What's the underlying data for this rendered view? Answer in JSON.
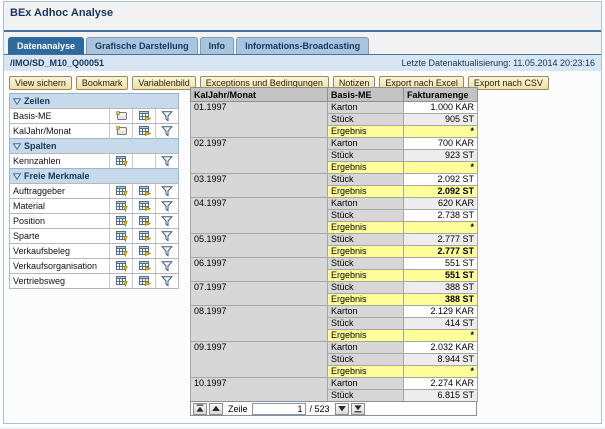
{
  "window": {
    "title": "BEx Adhoc Analyse"
  },
  "tabs": [
    {
      "id": "datenanalyse",
      "label": "Datenanalyse",
      "active": true
    },
    {
      "id": "grafische-darstellung",
      "label": "Grafische Darstellung",
      "active": false
    },
    {
      "id": "info",
      "label": "Info",
      "active": false
    },
    {
      "id": "informations-broadcasting",
      "label": "Informations-Broadcasting",
      "active": false
    }
  ],
  "query_bar": {
    "query_name": "/IMO/SD_M10_Q00051",
    "last_refresh": "Letzte Datenaktualisierung: 11.05.2014 20:23:16"
  },
  "toolbar": {
    "buttons": [
      {
        "id": "view-sichern",
        "label": "View sichern"
      },
      {
        "id": "bookmark",
        "label": "Bookmark"
      },
      {
        "id": "variablenbild",
        "label": "Variablenbild"
      },
      {
        "id": "exceptions-und-bedingungen",
        "label": "Exceptions und Bedingungen"
      },
      {
        "id": "notizen",
        "label": "Notizen"
      },
      {
        "id": "export-nach-excel",
        "label": "Export nach Excel"
      },
      {
        "id": "export-nach-csv",
        "label": "Export nach CSV"
      }
    ]
  },
  "navigation": {
    "sections": [
      {
        "id": "zeilen",
        "label": "Zeilen",
        "items": [
          {
            "id": "basis-me",
            "label": "Basis-ME",
            "icons": [
              "properties",
              "table-right",
              "filter"
            ]
          },
          {
            "id": "kaljahr-monat",
            "label": "KalJahr/Monat",
            "icons": [
              "properties",
              "table-right",
              "filter"
            ]
          }
        ]
      },
      {
        "id": "spalten",
        "label": "Spalten",
        "items": [
          {
            "id": "kennzahlen",
            "label": "Kennzahlen",
            "icons": [
              "table-down",
              null,
              "filter"
            ]
          }
        ]
      },
      {
        "id": "freie-merkmale",
        "label": "Freie Merkmale",
        "items": [
          {
            "id": "auftraggeber",
            "label": "Auftraggeber",
            "icons": [
              "table-down",
              "table-right",
              "filter"
            ]
          },
          {
            "id": "material",
            "label": "Material",
            "icons": [
              "table-down",
              "table-right",
              "filter"
            ]
          },
          {
            "id": "position",
            "label": "Position",
            "icons": [
              "table-down",
              "table-right",
              "filter"
            ]
          },
          {
            "id": "sparte",
            "label": "Sparte",
            "icons": [
              "table-down",
              "table-right",
              "filter"
            ]
          },
          {
            "id": "verkaufsbeleg",
            "label": "Verkaufsbeleg",
            "icons": [
              "table-down",
              "table-right",
              "filter"
            ]
          },
          {
            "id": "verkaufsorganisation",
            "label": "Verkaufsorganisation",
            "icons": [
              "table-down",
              "table-right",
              "filter"
            ]
          },
          {
            "id": "vertriebsweg",
            "label": "Vertriebsweg",
            "icons": [
              "table-down",
              "table-right",
              "filter"
            ]
          }
        ]
      }
    ]
  },
  "table": {
    "headers": [
      "KalJahr/Monat",
      "Basis-ME",
      "Fakturamenge"
    ],
    "result_label": "Ergebnis",
    "groups": [
      {
        "month": "01.1997",
        "rows": [
          {
            "label": "Karton",
            "value": "1.000 KAR"
          },
          {
            "label": "Stück",
            "value": "905 ST"
          },
          {
            "label": "Ergebnis",
            "value": "*",
            "result": true
          }
        ]
      },
      {
        "month": "02.1997",
        "rows": [
          {
            "label": "Karton",
            "value": "700 KAR"
          },
          {
            "label": "Stück",
            "value": "923 ST"
          },
          {
            "label": "Ergebnis",
            "value": "*",
            "result": true
          }
        ]
      },
      {
        "month": "03.1997",
        "rows": [
          {
            "label": "Stück",
            "value": "2.092 ST"
          },
          {
            "label": "Ergebnis",
            "value": "2.092 ST",
            "result": true
          }
        ]
      },
      {
        "month": "04.1997",
        "rows": [
          {
            "label": "Karton",
            "value": "620 KAR"
          },
          {
            "label": "Stück",
            "value": "2.738 ST"
          },
          {
            "label": "Ergebnis",
            "value": "*",
            "result": true
          }
        ]
      },
      {
        "month": "05.1997",
        "rows": [
          {
            "label": "Stück",
            "value": "2.777 ST"
          },
          {
            "label": "Ergebnis",
            "value": "2.777 ST",
            "result": true
          }
        ]
      },
      {
        "month": "06.1997",
        "rows": [
          {
            "label": "Stück",
            "value": "551 ST"
          },
          {
            "label": "Ergebnis",
            "value": "551 ST",
            "result": true
          }
        ]
      },
      {
        "month": "07.1997",
        "rows": [
          {
            "label": "Stück",
            "value": "388 ST"
          },
          {
            "label": "Ergebnis",
            "value": "388 ST",
            "result": true
          }
        ]
      },
      {
        "month": "08.1997",
        "rows": [
          {
            "label": "Karton",
            "value": "2.129 KAR"
          },
          {
            "label": "Stück",
            "value": "414 ST"
          },
          {
            "label": "Ergebnis",
            "value": "*",
            "result": true
          }
        ]
      },
      {
        "month": "09.1997",
        "rows": [
          {
            "label": "Karton",
            "value": "2.032 KAR"
          },
          {
            "label": "Stück",
            "value": "8.944 ST"
          },
          {
            "label": "Ergebnis",
            "value": "*",
            "result": true
          }
        ]
      },
      {
        "month": "10.1997",
        "rows": [
          {
            "label": "Karton",
            "value": "2.274 KAR"
          },
          {
            "label": "Stück",
            "value": "6.815 ST"
          }
        ]
      }
    ],
    "pager": {
      "label": "Zeile",
      "value": "1",
      "total": "/ 523"
    }
  },
  "colors": {
    "accent_blue": "#2e6a9e",
    "tab_inactive": "#a9c4dd",
    "query_bar": "#d8e5f2",
    "section_header": "#c7daec",
    "button_face": "#f3e5ba",
    "result_yellow": "#ffff99",
    "header_grey": "#c3c3c3",
    "cell_grey": "#d7d7d7"
  }
}
